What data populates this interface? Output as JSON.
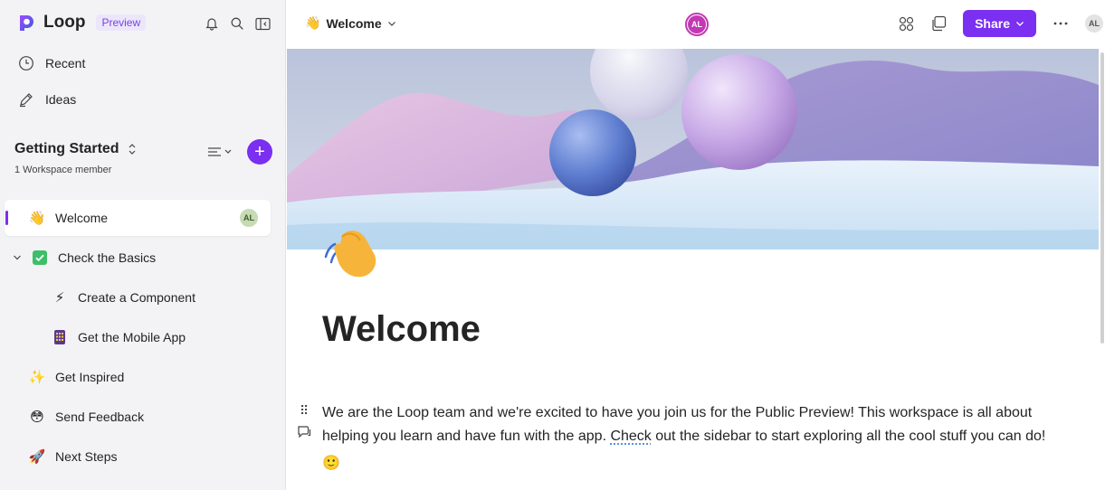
{
  "app": {
    "name": "Loop",
    "badge": "Preview"
  },
  "sidebar": {
    "nav": [
      {
        "label": "Recent",
        "icon": "clock-icon"
      },
      {
        "label": "Ideas",
        "icon": "pen-icon"
      }
    ],
    "workspace": {
      "title": "Getting Started",
      "subtitle": "1 Workspace member"
    },
    "pages": [
      {
        "label": "Welcome",
        "emoji": "👋",
        "avatar": "AL",
        "active": true
      },
      {
        "label": "Check the Basics",
        "emoji": "✅",
        "expanded": true
      },
      {
        "label": "Create a Component",
        "emoji": "⚡"
      },
      {
        "label": "Get the Mobile App",
        "emoji": "📱"
      },
      {
        "label": "Get Inspired",
        "emoji": "✨"
      },
      {
        "label": "Send Feedback",
        "emoji": "😳"
      },
      {
        "label": "Next Steps",
        "emoji": "🚀"
      }
    ]
  },
  "topbar": {
    "page_title": "Welcome",
    "page_emoji": "👋",
    "collaborator": "AL",
    "share_label": "Share",
    "user_avatar": "AL"
  },
  "content": {
    "heading": "Welcome",
    "paragraph_before": "We are the Loop team and we're excited to have you join us for the Public Preview! This workspace is all about helping you learn and have fun with the app. ",
    "paragraph_squiggle": "Check",
    "paragraph_after": " out the sidebar to start exploring all the cool stuff you can do!",
    "paragraph_emoji": "🙂"
  },
  "colors": {
    "accent": "#7b2ff0",
    "avatar_pink": "#c239b3"
  }
}
